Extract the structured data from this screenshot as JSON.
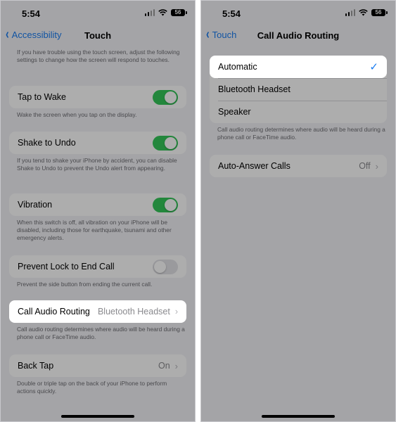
{
  "status_bar": {
    "time": "5:54",
    "battery": "56"
  },
  "left": {
    "nav": {
      "back_label": "Accessibility",
      "title": "Touch"
    },
    "intro_text": "If you have trouble using the touch screen, adjust the following settings to change how the screen will respond to touches.",
    "tap_to_wake": {
      "label": "Tap to Wake",
      "on": true,
      "footer": "Wake the screen when you tap on the display."
    },
    "shake_to_undo": {
      "label": "Shake to Undo",
      "on": true,
      "footer": "If you tend to shake your iPhone by accident, you can disable Shake to Undo to prevent the Undo alert from appearing."
    },
    "vibration": {
      "label": "Vibration",
      "on": true,
      "footer": "When this switch is off, all vibration on your iPhone will be disabled, including those for earthquake, tsunami and other emergency alerts."
    },
    "prevent_lock": {
      "label": "Prevent Lock to End Call",
      "on": false,
      "footer": "Prevent the side button from ending the current call."
    },
    "call_audio_routing": {
      "label": "Call Audio Routing",
      "value": "Bluetooth Headset",
      "footer": "Call audio routing determines where audio will be heard during a phone call or FaceTime audio."
    },
    "back_tap": {
      "label": "Back Tap",
      "value": "On",
      "footer": "Double or triple tap on the back of your iPhone to perform actions quickly."
    }
  },
  "right": {
    "nav": {
      "back_label": "Touch",
      "title": "Call Audio Routing"
    },
    "options": [
      {
        "label": "Automatic",
        "selected": true
      },
      {
        "label": "Bluetooth Headset",
        "selected": false
      },
      {
        "label": "Speaker",
        "selected": false
      }
    ],
    "options_footer": "Call audio routing determines where audio will be heard during a phone call or FaceTime audio.",
    "auto_answer": {
      "label": "Auto-Answer Calls",
      "value": "Off"
    }
  },
  "icons": {
    "check": "checkmark-icon",
    "chevron": "chevron-right-icon",
    "back": "chevron-left-icon"
  },
  "colors": {
    "accent": "#1a7cf0",
    "toggle_on": "#34c759",
    "background": "#f2f2f7"
  }
}
